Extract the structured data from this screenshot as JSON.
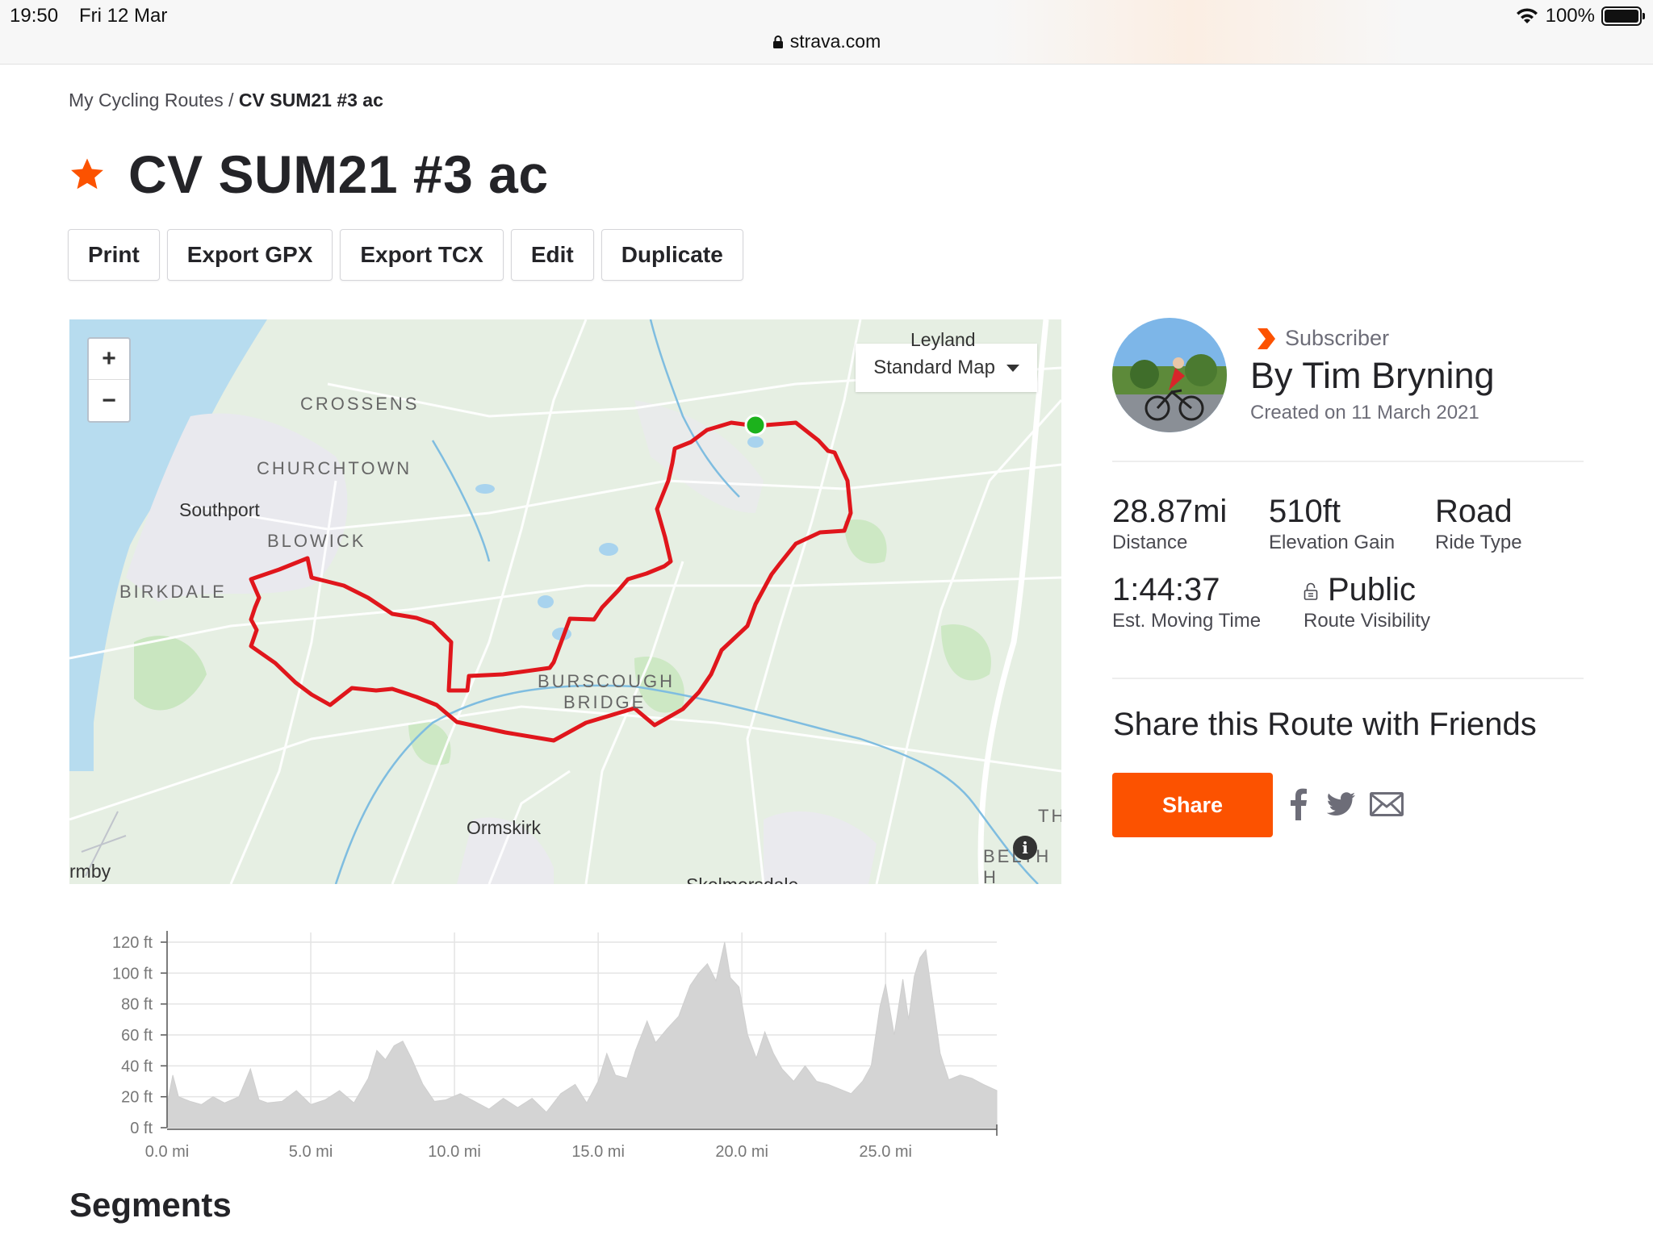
{
  "status_bar": {
    "time": "19:50",
    "date": "Fri 12 Mar",
    "battery": "100%",
    "url": "strava.com"
  },
  "breadcrumb": {
    "parent": "My Cycling Routes",
    "separator": " / ",
    "current": "CV SUM21 #3 ac"
  },
  "route": {
    "title": "CV SUM21 #3 ac",
    "starred": true
  },
  "actions": [
    "Print",
    "Export GPX",
    "Export TCX",
    "Edit",
    "Duplicate"
  ],
  "map": {
    "zoom_in": "+",
    "zoom_out": "−",
    "map_type": "Standard Map",
    "labels": {
      "leyland": "Leyland",
      "crossens": "CROSSENS",
      "churchtown": "CHURCHTOWN",
      "southport": "Southport",
      "blowick": "BLOWICK",
      "birkdale": "BIRKDALE",
      "burscough_1": "BURSCOUGH",
      "burscough_2": "BRIDGE",
      "ormskirk": "Ormskirk",
      "rmby": "rmby",
      "th": "TH",
      "belth": "BELTH H",
      "skelmersdale": "Skelmersdale"
    },
    "route_color": "#e0161c",
    "start_marker_color": "#1cb21c"
  },
  "athlete": {
    "subscriber_label": "Subscriber",
    "by": "By Tim Bryning",
    "created": "Created on 11 March 2021"
  },
  "stats": {
    "distance": {
      "value": "28.87mi",
      "label": "Distance"
    },
    "elevation": {
      "value": "510ft",
      "label": "Elevation Gain"
    },
    "type": {
      "value": "Road",
      "label": "Ride Type"
    },
    "time": {
      "value": "1:44:37",
      "label": "Est. Moving Time"
    },
    "visibility": {
      "value": "Public",
      "label": "Route Visibility"
    }
  },
  "share": {
    "title": "Share this Route with Friends",
    "button": "Share"
  },
  "segments_heading": "Segments",
  "chart_data": {
    "type": "area",
    "xlabel": "",
    "ylabel": "",
    "x_ticks": [
      "0.0 mi",
      "5.0 mi",
      "10.0 mi",
      "15.0 mi",
      "20.0 mi",
      "25.0 mi"
    ],
    "y_ticks": [
      "0 ft",
      "20 ft",
      "40 ft",
      "60 ft",
      "80 ft",
      "100 ft",
      "120 ft"
    ],
    "xlim": [
      0,
      28.87
    ],
    "ylim": [
      0,
      120
    ],
    "x": [
      0,
      0.2,
      0.4,
      0.8,
      1.2,
      1.6,
      2.0,
      2.5,
      2.9,
      3.2,
      3.5,
      4.0,
      4.5,
      5.0,
      5.5,
      6.0,
      6.5,
      7.0,
      7.3,
      7.6,
      7.9,
      8.2,
      8.5,
      8.9,
      9.3,
      9.7,
      10.2,
      10.7,
      11.2,
      11.7,
      12.2,
      12.7,
      13.2,
      13.7,
      14.2,
      14.6,
      15.0,
      15.3,
      15.6,
      16.0,
      16.3,
      16.7,
      17.0,
      17.4,
      17.8,
      18.2,
      18.5,
      18.8,
      19.1,
      19.4,
      19.6,
      19.9,
      20.2,
      20.5,
      20.8,
      21.1,
      21.4,
      21.8,
      22.2,
      22.6,
      23.0,
      23.4,
      23.8,
      24.2,
      24.5,
      24.8,
      25.0,
      25.3,
      25.6,
      25.8,
      26.0,
      26.2,
      26.4,
      26.7,
      26.9,
      27.2,
      27.6,
      28.0,
      28.4,
      28.87
    ],
    "y": [
      15,
      34,
      20,
      17,
      15,
      20,
      16,
      20,
      38,
      18,
      16,
      17,
      24,
      15,
      18,
      24,
      16,
      32,
      50,
      44,
      53,
      56,
      45,
      28,
      17,
      18,
      22,
      17,
      12,
      19,
      13,
      19,
      10,
      22,
      28,
      16,
      30,
      48,
      34,
      32,
      50,
      69,
      55,
      64,
      72,
      92,
      100,
      106,
      95,
      120,
      97,
      91,
      60,
      45,
      62,
      48,
      38,
      30,
      40,
      30,
      28,
      25,
      22,
      30,
      40,
      78,
      93,
      60,
      96,
      70,
      98,
      110,
      115,
      75,
      48,
      31,
      34,
      32,
      28,
      24
    ]
  }
}
